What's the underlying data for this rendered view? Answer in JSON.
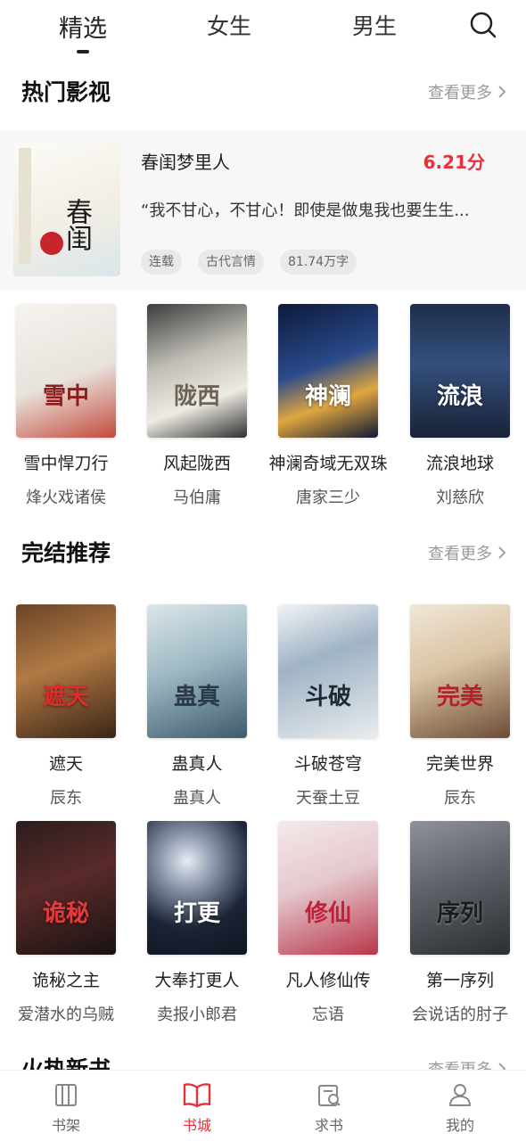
{
  "top_tabs": [
    {
      "label": "精选",
      "active": true
    },
    {
      "label": "女生",
      "active": false
    },
    {
      "label": "男生",
      "active": false
    }
  ],
  "icons": {
    "search": "search-icon"
  },
  "hot_video": {
    "title": "热门影视",
    "more": "查看更多",
    "featured": {
      "title": "春闺梦里人",
      "score": "6.21分",
      "desc": "“我不甘心，不甘心！即使是做鬼我也要生生...",
      "tags": [
        "连载",
        "古代言情",
        "81.74万字"
      ],
      "cover_text": "春闺"
    },
    "books": [
      {
        "title": "雪中悍刀行",
        "author": "烽火戏诸侯",
        "cover_text": "雪中"
      },
      {
        "title": "风起陇西",
        "author": "马伯庸",
        "cover_text": "陇西"
      },
      {
        "title": "神澜奇域无双珠",
        "author": "唐家三少",
        "cover_text": "神澜"
      },
      {
        "title": "流浪地球",
        "author": "刘慈欣",
        "cover_text": "流浪"
      }
    ]
  },
  "completed": {
    "title": "完结推荐",
    "more": "查看更多",
    "books": [
      {
        "title": "遮天",
        "author": "辰东",
        "cover_text": "遮天"
      },
      {
        "title": "蛊真人",
        "author": "蛊真人",
        "cover_text": "蛊真"
      },
      {
        "title": "斗破苍穹",
        "author": "天蚕土豆",
        "cover_text": "斗破"
      },
      {
        "title": "完美世界",
        "author": "辰东",
        "cover_text": "完美"
      },
      {
        "title": "诡秘之主",
        "author": "爱潜水的乌贼",
        "cover_text": "诡秘"
      },
      {
        "title": "大奉打更人",
        "author": "卖报小郎君",
        "cover_text": "打更"
      },
      {
        "title": "凡人修仙传",
        "author": "忘语",
        "cover_text": "修仙"
      },
      {
        "title": "第一序列",
        "author": "会说话的肘子",
        "cover_text": "序列"
      }
    ]
  },
  "hot_new": {
    "title": "火热新书",
    "more": "查看更多"
  },
  "bottom_nav": [
    {
      "label": "书架",
      "icon": "bookshelf-icon",
      "active": false
    },
    {
      "label": "书城",
      "icon": "book-open-icon",
      "active": true
    },
    {
      "label": "求书",
      "icon": "request-book-icon",
      "active": false
    },
    {
      "label": "我的",
      "icon": "user-icon",
      "active": false
    }
  ],
  "colors": {
    "accent": "#e8303a",
    "muted": "#9a9a9a"
  }
}
